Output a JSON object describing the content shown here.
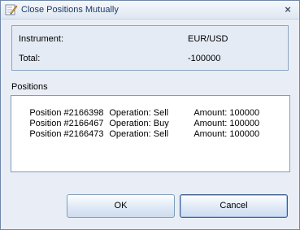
{
  "window": {
    "title": "Close Positions Mutually",
    "close_symbol": "×",
    "icon": "pencil-edit-icon"
  },
  "info": {
    "instrument_label": "Instrument:",
    "instrument_value": "EUR/USD",
    "total_label": "Total:",
    "total_value": "-100000"
  },
  "positions": {
    "label": "Positions",
    "items": [
      {
        "position": "Position #2166398",
        "operation": "Operation: Sell",
        "amount": "Amount: 100000"
      },
      {
        "position": "Position #2166467",
        "operation": "Operation: Buy",
        "amount": "Amount: 100000"
      },
      {
        "position": "Position #2166473",
        "operation": "Operation: Sell",
        "amount": "Amount: 100000"
      }
    ]
  },
  "buttons": {
    "ok_label": "OK",
    "cancel_label": "Cancel"
  }
}
